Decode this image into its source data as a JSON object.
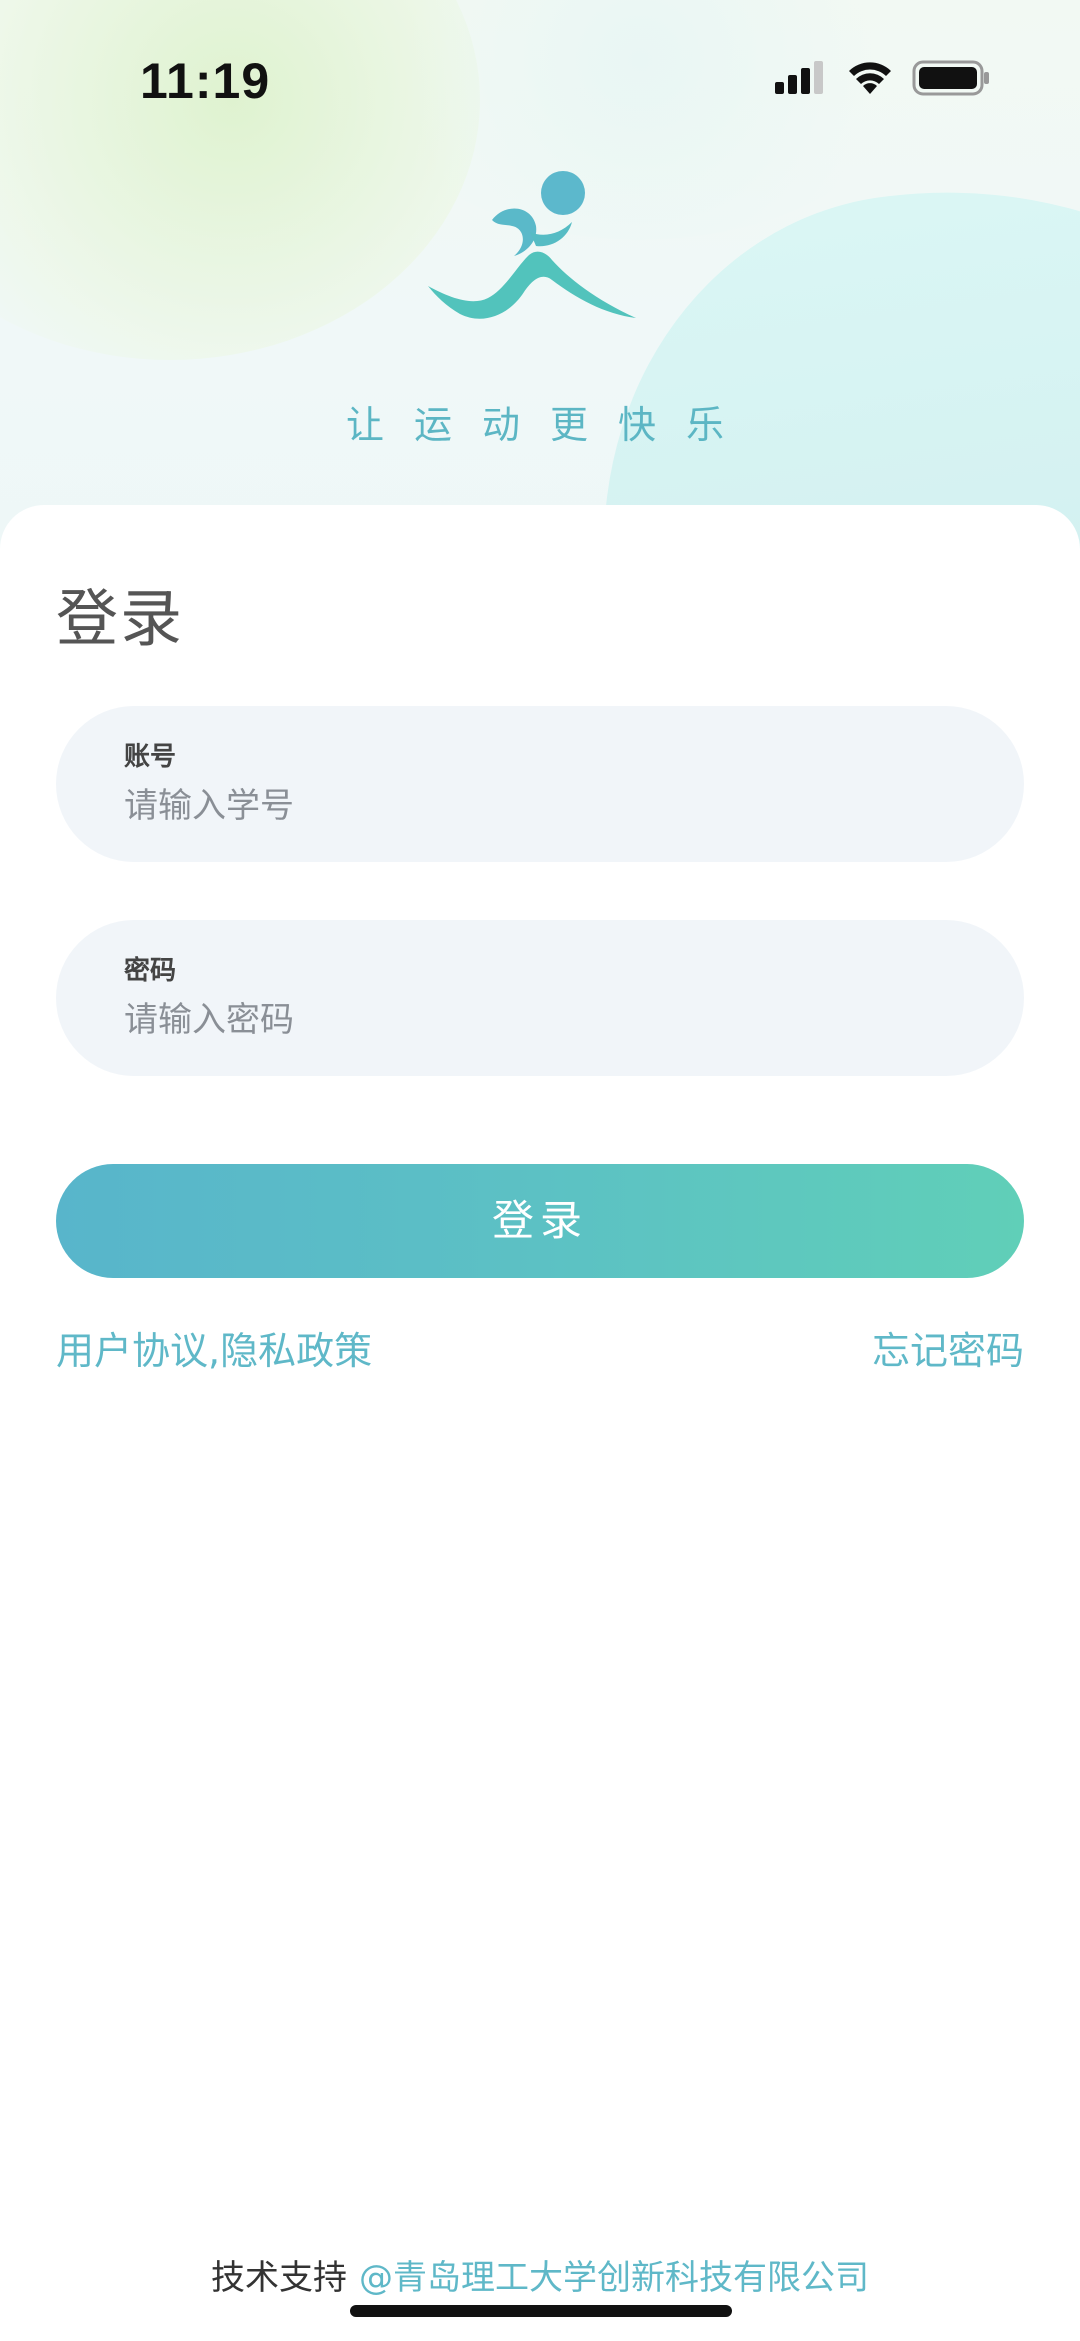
{
  "status_bar": {
    "time": "11:19"
  },
  "header": {
    "slogan": "让运动更快乐",
    "logo_icon": "running-person-logo",
    "colors": {
      "logo_head": "#5cb8cc",
      "logo_body": "#52c3bc"
    }
  },
  "login": {
    "title": "登录",
    "account": {
      "label": "账号",
      "placeholder": "请输入学号",
      "value": ""
    },
    "password": {
      "label": "密码",
      "placeholder": "请输入密码",
      "value": ""
    },
    "submit_label": "登录",
    "agreement_link": "用户协议,隐私政策",
    "forgot_link": "忘记密码"
  },
  "footer": {
    "prefix": "技术支持",
    "company": "@青岛理工大学创新科技有限公司"
  },
  "theme": {
    "accent": "#5fb8c8",
    "button_gradient_start": "#58b5cb",
    "button_gradient_end": "#60cfb8",
    "field_background": "#f1f5f9"
  }
}
